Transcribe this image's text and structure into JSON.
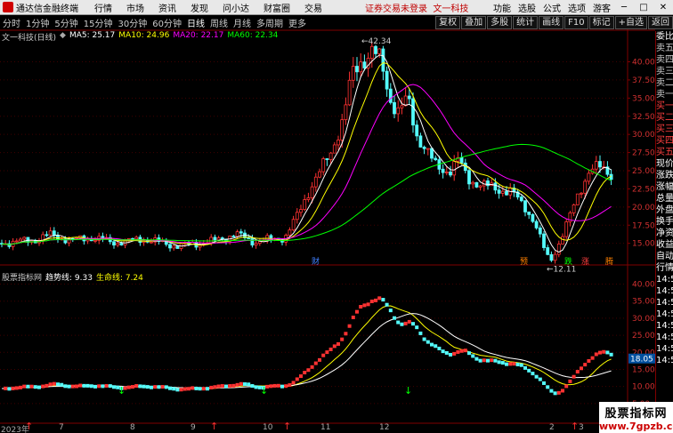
{
  "menubar": {
    "app_name": "通达信金融终端",
    "items": [
      "行情",
      "市场",
      "资讯",
      "发现",
      "问小达",
      "财富圈",
      "交易"
    ],
    "notice": "证券交易未登录",
    "stock_title": "文一科技",
    "right_items": [
      "功能",
      "选股",
      "公式",
      "选项",
      "游客"
    ]
  },
  "periods": [
    "分时",
    "1分钟",
    "5分钟",
    "15分钟",
    "30分钟",
    "60分钟",
    "日线",
    "周线",
    "月线",
    "多周期",
    "更多"
  ],
  "active_period": "日线",
  "toolbar": [
    "复权",
    "叠加",
    "多股",
    "统计",
    "画线",
    "F10",
    "标记",
    "+自选",
    "返回"
  ],
  "ma_legend": {
    "stock": "文一科技(日线)",
    "ma5": "MA5: 25.17",
    "ma10": "MA10: 24.96",
    "ma20": "MA20: 22.17",
    "ma60": "MA60: 22.34"
  },
  "colors": {
    "ma5": "#ffffff",
    "ma10": "#ffff00",
    "ma20": "#ff00ff",
    "ma60": "#00ff00",
    "up": "#ff3232",
    "down": "#54fcfc",
    "grid": "#800000"
  },
  "sidepanel": [
    "委比",
    "卖五",
    "卖四",
    "卖三",
    "卖二",
    "卖一",
    "买一",
    "买二",
    "买三",
    "买四",
    "买五",
    "现价",
    "涨跌",
    "涨幅",
    "总量",
    "外盘",
    "换手",
    "净资",
    "收益",
    "自动",
    "行情",
    "14:50",
    "14:50",
    "14:50",
    "14:50",
    "14:50",
    "14:50",
    "14:50",
    "14:50"
  ],
  "indicator": {
    "name": "股票指标网",
    "trend": "趋势线: 9.33",
    "life": "生命线: 7.24"
  },
  "price_axis": [
    "40.00",
    "37.50",
    "35.00",
    "32.50",
    "30.00",
    "27.50",
    "25.00",
    "22.50",
    "20.00",
    "17.50",
    "15.00"
  ],
  "ind_axis": [
    "40.00",
    "35.00",
    "30.00",
    "25.00",
    "20.00",
    "15.00",
    "10.00",
    "5.00"
  ],
  "current_price_tag": "18.05",
  "annotations": {
    "high": "42.34",
    "low": "12.11"
  },
  "markers": [
    "财",
    "预",
    "跌",
    "涨",
    "腾"
  ],
  "xaxis": [
    "2023年",
    "7",
    "8",
    "9",
    "10",
    "11",
    "12",
    "2",
    "3"
  ],
  "watermark": {
    "line1": "股票指标网",
    "line2": "www.7gpzb.com"
  }
}
